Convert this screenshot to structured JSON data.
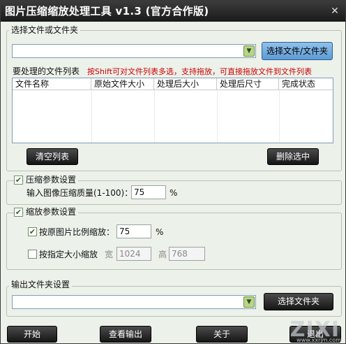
{
  "window": {
    "title": "图片压缩缩放处理工具 v1.3 (官方合作版)"
  },
  "file_section": {
    "label": "选择文件或文件夹",
    "combo_value": "",
    "select_button": "选择文件/文件夹",
    "list_label": "要处理的文件列表",
    "hint": "按Shift可对文件列表多选，支持拖放，可直接拖放文件到文件列表",
    "columns": [
      "文件名称",
      "原始文件大小",
      "处理后大小",
      "处理后尺寸",
      "完成状态"
    ],
    "clear_button": "清空列表",
    "delete_button": "删除选中"
  },
  "compress_section": {
    "label": "压缩参数设置",
    "checked": true,
    "quality_label": "输入图像压缩质量(1-100)：",
    "quality_value": "75",
    "unit": "%"
  },
  "scale_section": {
    "label": "缩放参数设置",
    "checked": true,
    "ratio_label": "按原图片比例缩放：",
    "ratio_checked": true,
    "ratio_value": "75",
    "unit": "%",
    "size_label": "按指定大小缩放",
    "size_checked": false,
    "width_label": "宽",
    "width_value": "1024",
    "height_label": "高",
    "height_value": "768"
  },
  "output_section": {
    "label": "输出文件夹设置",
    "combo_value": "",
    "select_button": "选择文件夹"
  },
  "bottom_buttons": {
    "start": "开始",
    "view_output": "查看输出",
    "about": "关于",
    "exit": "退出"
  },
  "watermark": "ZIXI",
  "watermark_sub": "www.xxrjm.com"
}
